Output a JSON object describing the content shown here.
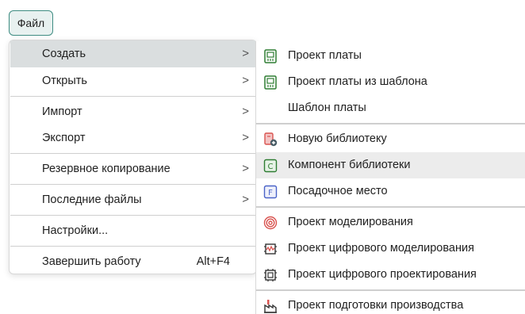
{
  "file_button": {
    "label": "Файл"
  },
  "menu": {
    "items": [
      {
        "label": "Создать",
        "arrow": ">"
      },
      {
        "label": "Открыть",
        "arrow": ">"
      },
      {
        "label": "Импорт",
        "arrow": ">"
      },
      {
        "label": "Экспорт",
        "arrow": ">"
      },
      {
        "label": "Резервное копирование",
        "arrow": ">"
      },
      {
        "label": "Последние файлы",
        "arrow": ">"
      },
      {
        "label": "Настройки..."
      },
      {
        "label": "Завершить работу",
        "shortcut": "Alt+F4"
      }
    ]
  },
  "submenu": {
    "items": [
      {
        "label": "Проект платы",
        "icon": "board-project-icon"
      },
      {
        "label": "Проект платы из шаблона",
        "icon": "board-template-project-icon"
      },
      {
        "label": "Шаблон платы"
      },
      {
        "label": "Новую библиотеку",
        "icon": "new-library-icon"
      },
      {
        "label": "Компонент библиотеки",
        "icon": "library-component-icon",
        "icon_letter": "C"
      },
      {
        "label": "Посадочное место",
        "icon": "footprint-icon",
        "icon_letter": "F"
      },
      {
        "label": "Проект моделирования",
        "icon": "simulation-project-icon"
      },
      {
        "label": "Проект цифрового моделирования",
        "icon": "digital-simulation-icon"
      },
      {
        "label": "Проект цифрового проектирования",
        "icon": "digital-design-icon"
      },
      {
        "label": "Проект подготовки производства",
        "icon": "manufacturing-icon"
      }
    ]
  },
  "colors": {
    "accent": "#3e8c82",
    "green_icon": "#2e7d32",
    "blue_icon": "#4a63c8",
    "red_icon": "#d9534f",
    "hover": "#dadedf"
  }
}
